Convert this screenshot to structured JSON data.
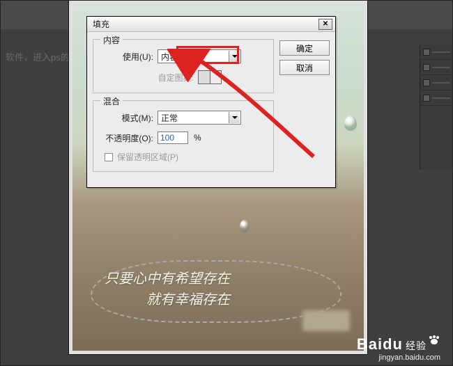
{
  "background": {
    "faint_text": "软件，进入ps的操作"
  },
  "photo": {
    "line1": "只要心中有希望存在",
    "line2": "就有幸福存在"
  },
  "dialog": {
    "title": "填充",
    "buttons": {
      "ok": "确定",
      "cancel": "取消"
    },
    "content_group": {
      "title": "内容",
      "use_label": "使用(U):",
      "use_value": "内容识别",
      "custom_pattern_label": "自定图案:"
    },
    "blend_group": {
      "title": "混合",
      "mode_label": "模式(M):",
      "mode_value": "正常",
      "opacity_label": "不透明度(O):",
      "opacity_value": "100",
      "opacity_unit": "%",
      "preserve_label": "保留透明区域(P)"
    }
  },
  "watermark": {
    "brand": "Baidu",
    "sub": "经验",
    "url": "jingyan.baidu.com"
  }
}
